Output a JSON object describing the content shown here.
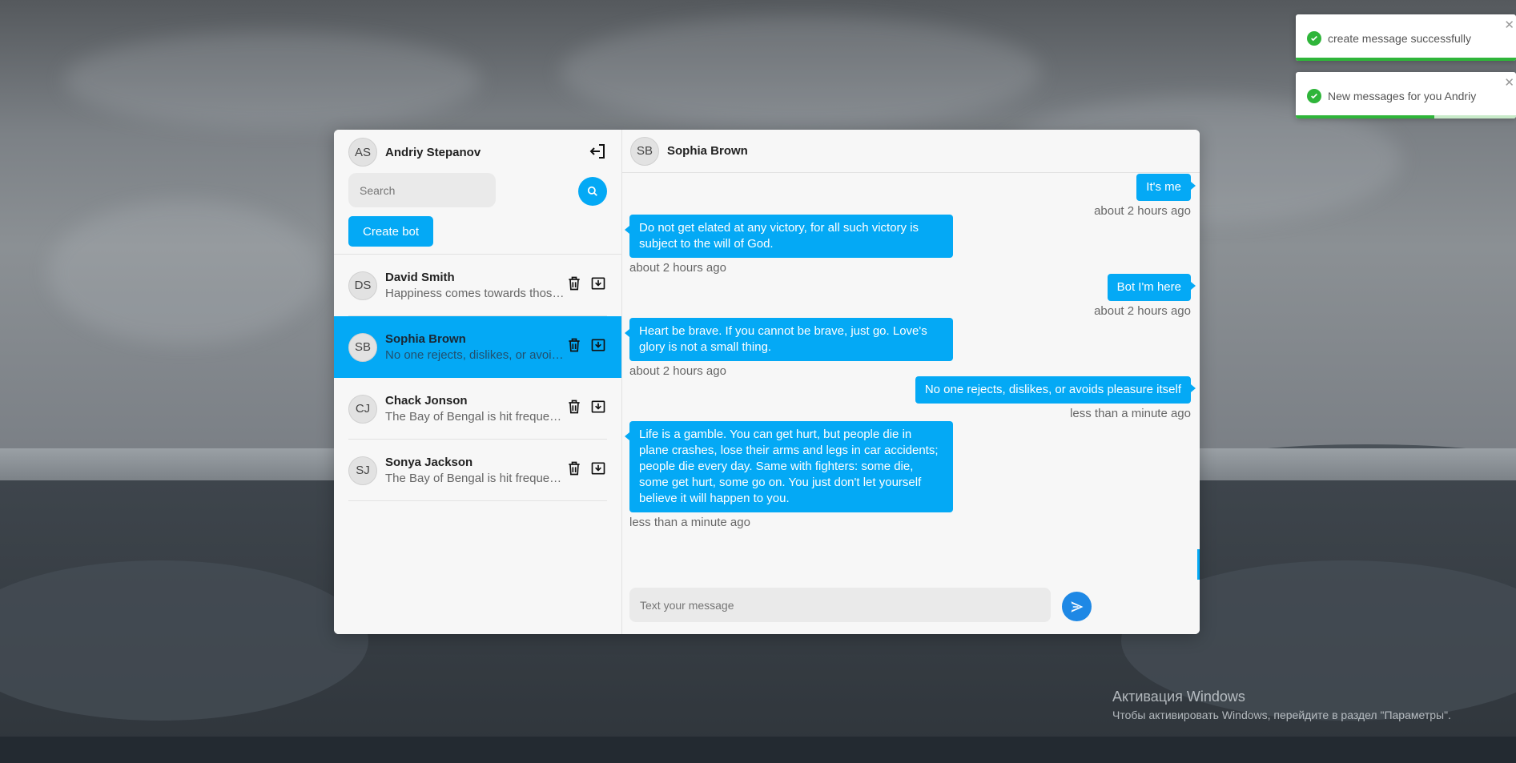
{
  "current_user": {
    "initials": "AS",
    "name": "Andriy Stepanov"
  },
  "search": {
    "placeholder": "Search",
    "value": ""
  },
  "create_bot_label": "Create bot",
  "contacts": [
    {
      "initials": "DS",
      "name": "David Smith",
      "last": "Happiness comes towards those who accept their dreams",
      "active": false
    },
    {
      "initials": "SB",
      "name": "Sophia Brown",
      "last": "No one rejects, dislikes, or avoids pleasure itself",
      "active": true
    },
    {
      "initials": "CJ",
      "name": "Chack Jonson",
      "last": "The Bay of Bengal is hit frequently by cyclones",
      "active": false
    },
    {
      "initials": "SJ",
      "name": "Sonya Jackson",
      "last": "The Bay of Bengal is hit frequently by cyclones",
      "active": false
    }
  ],
  "chat": {
    "initials": "SB",
    "name": "Sophia Brown",
    "messages": [
      {
        "dir": "out",
        "text": "It's me",
        "time": "about 2 hours ago"
      },
      {
        "dir": "in",
        "text": "Do not get elated at any victory, for all such victory is subject to the will of God.",
        "time": "about 2 hours ago"
      },
      {
        "dir": "out",
        "text": "Bot I'm here",
        "time": "about 2 hours ago"
      },
      {
        "dir": "in",
        "text": "Heart be brave. If you cannot be brave, just go. Love's glory is not a small thing.",
        "time": "about 2 hours ago"
      },
      {
        "dir": "out",
        "text": "No one rejects, dislikes, or avoids pleasure itself",
        "time": "less than a minute ago"
      },
      {
        "dir": "in",
        "text": "Life is a gamble. You can get hurt, but people die in plane crashes, lose their arms and legs in car accidents; people die every day. Same with fighters: some die, some get hurt, some go on. You just don't let yourself believe it will happen to you.",
        "time": "less than a minute ago"
      }
    ],
    "composer_placeholder": "Text your message"
  },
  "toasts": [
    {
      "text": "create message successfully",
      "progress": 1.0
    },
    {
      "text": "New messages for you Andriy",
      "progress": 0.63
    }
  ],
  "windows_activation": {
    "title": "Активация Windows",
    "subtitle": "Чтобы активировать Windows, перейдите в раздел \"Параметры\"."
  },
  "colors": {
    "accent": "#04a9f5",
    "send": "#1e88e5",
    "success": "#2fb53a"
  }
}
